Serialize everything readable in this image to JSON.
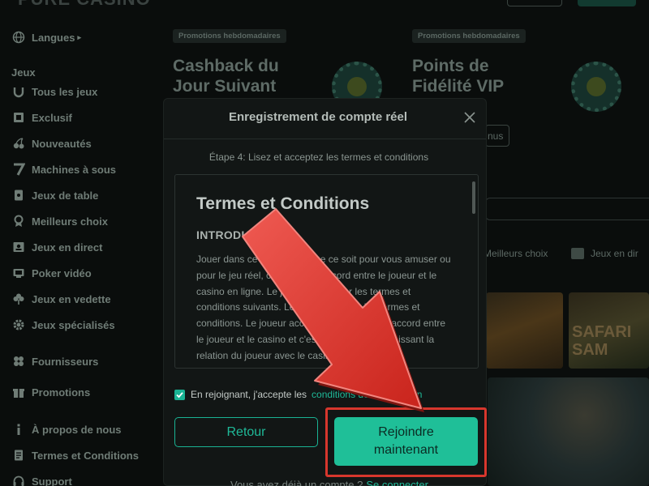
{
  "header": {
    "logo_text": "PURE CASINO"
  },
  "sidebar": {
    "languages": "Langues",
    "section_heading": "Jeux",
    "games": [
      {
        "label": "Tous les jeux",
        "icon": "horseshoe-icon"
      },
      {
        "label": "Exclusif",
        "icon": "exclusive-icon"
      },
      {
        "label": "Nouveautés",
        "icon": "cherries-icon"
      },
      {
        "label": "Machines à sous",
        "icon": "seven-icon"
      },
      {
        "label": "Jeux de table",
        "icon": "card-icon"
      },
      {
        "label": "Meilleurs choix",
        "icon": "medal-icon"
      },
      {
        "label": "Jeux en direct",
        "icon": "live-dealer-icon"
      },
      {
        "label": "Poker vidéo",
        "icon": "video-poker-icon"
      },
      {
        "label": "Jeux en vedette",
        "icon": "clover-icon"
      },
      {
        "label": "Jeux spécialisés",
        "icon": "gear-icon"
      }
    ],
    "other": [
      {
        "label": "Fournisseurs",
        "icon": "providers-icon"
      },
      {
        "label": "Promotions",
        "icon": "gift-icon"
      },
      {
        "label": "À propos de nous",
        "icon": "info-icon"
      },
      {
        "label": "Termes et Conditions",
        "icon": "document-icon"
      },
      {
        "label": "Support",
        "icon": "headset-icon"
      }
    ]
  },
  "promos": [
    {
      "tag": "Promotions hebdomadaires",
      "title": "Cashback du Jour Suivant"
    },
    {
      "tag": "Promotions hebdomadaires",
      "title": "Points de Fidélité VIP"
    }
  ],
  "background": {
    "pill_text": "nus",
    "categories": [
      "Meilleurs choix",
      "Jeux en dir"
    ],
    "tile_text": "SAFARI SAM"
  },
  "modal": {
    "title": "Enregistrement de compte réel",
    "step": "Étape 4: Lisez et acceptez les termes et conditions",
    "terms_title": "Termes et Conditions",
    "terms_section": "INTRODUCTION",
    "terms_body": "Jouer dans ce casino, qui que ce soit pour vous amuser ou pour le jeu réel, constitue un accord entre le joueur et le casino en ligne. Le joueur est lié par les termes et conditions suivants. Le joueur accepte les termes et conditions. Le joueur accepte qu'il s'agit d'un accord entre le joueur et le casino et c'est le seul accord régissant la relation du joueur avec le casino à",
    "agree_text": "En rejoignant, j'accepte les",
    "agree_link": "conditions de l'application",
    "back_button": "Retour",
    "join_button": "Rejoindre maintenant",
    "login_prompt": "Vous avez déjà un compte ?",
    "login_link": "Se connecter"
  },
  "colors": {
    "accent": "#1fbf98",
    "annotation": "#d7372d",
    "modal_bg": "#121615"
  }
}
